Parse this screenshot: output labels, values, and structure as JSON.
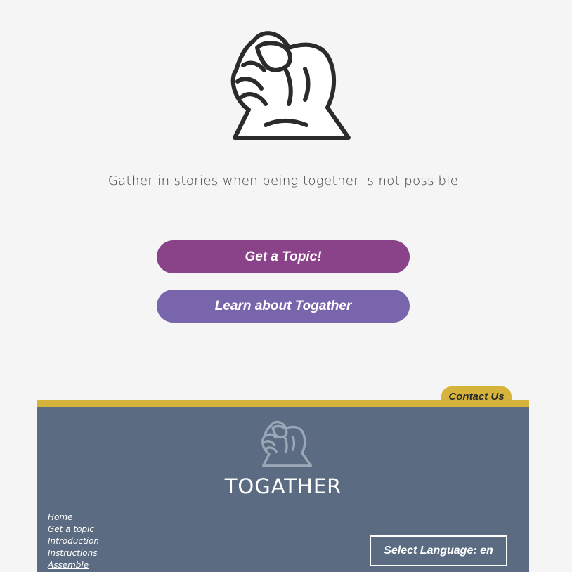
{
  "hero": {
    "logo_icon": "clasped-hands-icon",
    "tagline": "Gather in stories when being together is not possible"
  },
  "actions": {
    "get_topic_label": "Get a Topic!",
    "learn_label": "Learn about Togather"
  },
  "footer": {
    "contact_label": "Contact Us",
    "logo_icon": "clasped-hands-icon",
    "brand": "TOGATHER",
    "links": [
      {
        "label": "Home"
      },
      {
        "label": "Get a topic"
      },
      {
        "label": "Introduction"
      },
      {
        "label": "Instructions"
      },
      {
        "label": "Assemble"
      }
    ],
    "language_label": "Select Language: en"
  },
  "colors": {
    "background": "#f5f5f5",
    "primary_button": "#8a4388",
    "secondary_button": "#7965ab",
    "accent_gold": "#d6b33b",
    "footer_bg": "#5a6b82"
  }
}
